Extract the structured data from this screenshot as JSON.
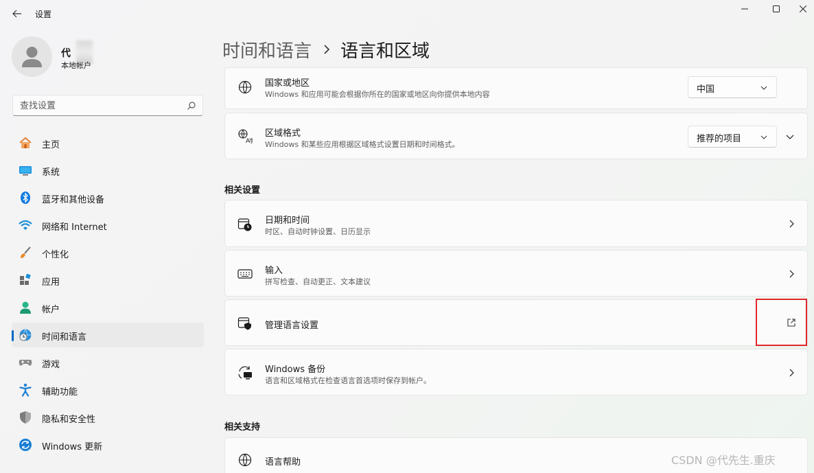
{
  "window": {
    "title": "设置"
  },
  "profile": {
    "name": "代",
    "account_type": "本地帐户"
  },
  "search": {
    "placeholder": "查找设置"
  },
  "nav": {
    "items": [
      {
        "label": "主页",
        "icon": "home-icon"
      },
      {
        "label": "系统",
        "icon": "system-icon"
      },
      {
        "label": "蓝牙和其他设备",
        "icon": "bluetooth-icon"
      },
      {
        "label": "网络和 Internet",
        "icon": "wifi-icon"
      },
      {
        "label": "个性化",
        "icon": "brush-icon"
      },
      {
        "label": "应用",
        "icon": "apps-icon"
      },
      {
        "label": "帐户",
        "icon": "account-icon"
      },
      {
        "label": "时间和语言",
        "icon": "time-language-icon",
        "active": true
      },
      {
        "label": "游戏",
        "icon": "gaming-icon"
      },
      {
        "label": "辅助功能",
        "icon": "accessibility-icon"
      },
      {
        "label": "隐私和安全性",
        "icon": "shield-icon"
      },
      {
        "label": "Windows 更新",
        "icon": "update-icon"
      }
    ]
  },
  "breadcrumb": {
    "parent": "时间和语言",
    "current": "语言和区域"
  },
  "region_cards": [
    {
      "title": "国家或地区",
      "desc": "Windows 和应用可能会根据你所在的国家或地区向你提供本地内容",
      "value": "中国",
      "icon": "globe-icon"
    },
    {
      "title": "区域格式",
      "desc": "Windows 和某些应用根据区域格式设置日期和时间格式。",
      "value": "推荐的项目",
      "icon": "regional-format-icon"
    }
  ],
  "related_settings": {
    "heading": "相关设置",
    "items": [
      {
        "title": "日期和时间",
        "desc": "时区、自动时钟设置、日历显示",
        "icon": "calendar-clock-icon"
      },
      {
        "title": "输入",
        "desc": "拼写检查、自动更正、文本建议",
        "icon": "keyboard-icon"
      },
      {
        "title": "管理语言设置",
        "desc": "",
        "icon": "admin-language-icon"
      },
      {
        "title": "Windows 备份",
        "desc": "语言和区域格式在检查语言首选项时保存到帐户。",
        "icon": "backup-icon"
      }
    ]
  },
  "related_support": {
    "heading": "相关支持",
    "items": [
      {
        "title": "语言帮助",
        "icon": "globe-icon"
      }
    ]
  },
  "watermark": "CSDN @代先生.重庆",
  "colors": {
    "accent": "#0067c0",
    "highlight": "#e0282b"
  }
}
